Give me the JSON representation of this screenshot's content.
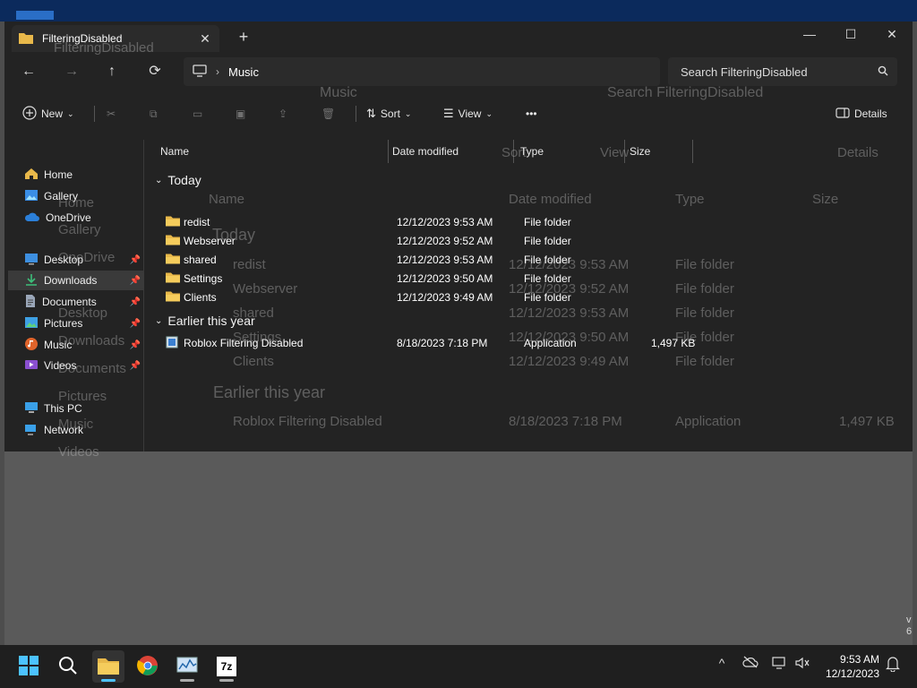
{
  "window": {
    "tab_title": "FilteringDisabled",
    "new_tab": "+",
    "minimize": "—",
    "maximize": "☐",
    "close": "✕"
  },
  "nav": {
    "back": "←",
    "forward": "→",
    "up": "↑",
    "refresh": "⟳",
    "breadcrumb": "Music",
    "search_placeholder": "Search FilteringDisabled"
  },
  "toolbar": {
    "new_label": "New",
    "sort_label": "Sort",
    "view_label": "View",
    "more_label": "•••",
    "details_label": "Details"
  },
  "sidebar": {
    "items": [
      {
        "label": "Home",
        "icon": "home-icon",
        "pinned": false
      },
      {
        "label": "Gallery",
        "icon": "gallery-icon",
        "pinned": false
      },
      {
        "label": "OneDrive",
        "icon": "cloud-icon",
        "pinned": false
      },
      {
        "label": "Desktop",
        "icon": "desktop-icon",
        "pinned": true
      },
      {
        "label": "Downloads",
        "icon": "download-icon",
        "pinned": true
      },
      {
        "label": "Documents",
        "icon": "document-icon",
        "pinned": true
      },
      {
        "label": "Pictures",
        "icon": "picture-icon",
        "pinned": true
      },
      {
        "label": "Music",
        "icon": "music-icon",
        "pinned": true
      },
      {
        "label": "Videos",
        "icon": "video-icon",
        "pinned": true
      },
      {
        "label": "This PC",
        "icon": "computer-icon",
        "pinned": false
      },
      {
        "label": "Network",
        "icon": "network-icon",
        "pinned": false
      }
    ]
  },
  "columns": {
    "name": "Name",
    "date": "Date modified",
    "type": "Type",
    "size": "Size"
  },
  "groups": {
    "today": "Today",
    "earlier": "Earlier this year"
  },
  "files_today": [
    {
      "name": "redist",
      "date": "12/12/2023 9:53 AM",
      "type": "File folder",
      "size": ""
    },
    {
      "name": "Webserver",
      "date": "12/12/2023 9:52 AM",
      "type": "File folder",
      "size": ""
    },
    {
      "name": "shared",
      "date": "12/12/2023 9:53 AM",
      "type": "File folder",
      "size": ""
    },
    {
      "name": "Settings",
      "date": "12/12/2023 9:50 AM",
      "type": "File folder",
      "size": ""
    },
    {
      "name": "Clients",
      "date": "12/12/2023 9:49 AM",
      "type": "File folder",
      "size": ""
    }
  ],
  "files_earlier": [
    {
      "name": "Roblox Filtering Disabled",
      "date": "8/18/2023 7:18 PM",
      "type": "Application",
      "size": "1,497 KB"
    }
  ],
  "ghost": {
    "tab_title": "FilteringDisabled",
    "breadcrumb": "Music",
    "search": "Search FilteringDisabled",
    "sort": "Sort",
    "view": "View",
    "details": "Details",
    "col_name": "Name",
    "col_date": "Date modified",
    "col_type": "Type",
    "col_size": "Size",
    "today": "Today",
    "earlier": "Earlier this year",
    "side_home": "Home",
    "side_gallery": "Gallery",
    "side_onedrive": "OneDrive",
    "side_desktop": "Desktop",
    "side_downloads": "Downloads",
    "side_documents": "Documents",
    "side_pictures": "Pictures",
    "side_music": "Music",
    "side_videos": "Videos",
    "rows": [
      {
        "name": "redist",
        "date": "12/12/2023 9:53 AM",
        "type": "File folder",
        "size": ""
      },
      {
        "name": "Webserver",
        "date": "12/12/2023 9:52 AM",
        "type": "File folder",
        "size": ""
      },
      {
        "name": "shared",
        "date": "12/12/2023 9:53 AM",
        "type": "File folder",
        "size": ""
      },
      {
        "name": "Settings",
        "date": "12/12/2023 9:50 AM",
        "type": "File folder",
        "size": ""
      },
      {
        "name": "Clients",
        "date": "12/12/2023 9:49 AM",
        "type": "File folder",
        "size": ""
      }
    ],
    "app_row": {
      "name": "Roblox Filtering Disabled",
      "date": "8/18/2023 7:18 PM",
      "type": "Application",
      "size": "1,497 KB"
    }
  },
  "taskbar": {
    "time": "9:53 AM",
    "date": "12/12/2023",
    "chevron": "^",
    "app_label_7z": "7z"
  },
  "corner": {
    "line1": "v",
    "line2": "6"
  },
  "colors": {
    "folder": "#e8b84a",
    "accent": "#4cc2ff",
    "window_bg": "#1c1c1c",
    "taskbar_bg": "#1f1f1f"
  }
}
